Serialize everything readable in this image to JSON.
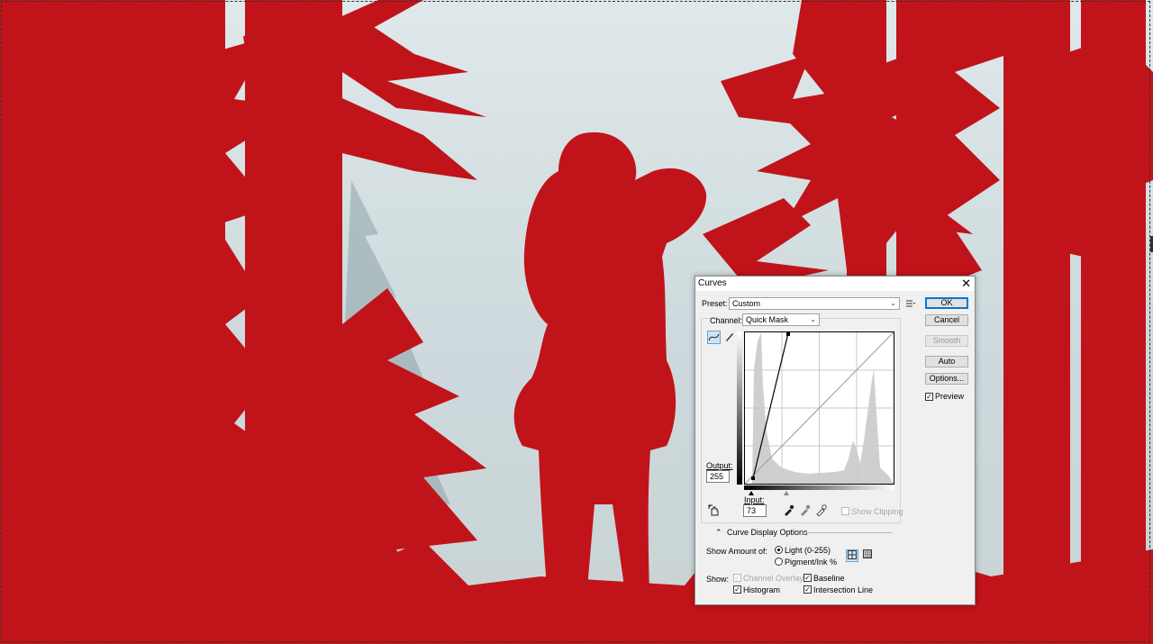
{
  "dialog": {
    "title": "Curves",
    "close_glyph": "✕",
    "preset_label": "Preset:",
    "preset_value": "Custom",
    "preset_options_icon": "preset-menu-icon",
    "channel_label": "Channel:",
    "channel_value": "Quick Mask",
    "buttons": {
      "ok": "OK",
      "cancel": "Cancel",
      "smooth": "Smooth",
      "auto": "Auto",
      "options": "Options..."
    },
    "preview_label": "Preview",
    "preview_checked": true,
    "output_label": "Output:",
    "output_value": "255",
    "input_label": "Input:",
    "input_value": "73",
    "show_clipping_label": "Show Clipping",
    "curve_display_options_label": "Curve Display Options",
    "show_amount_label": "Show Amount of:",
    "light_label": "Light  (0-255)",
    "pigment_label": "Pigment/Ink %",
    "show_label": "Show:",
    "channel_overlays_label": "Channel Overlays",
    "baseline_label": "Baseline",
    "histogram_label": "Histogram",
    "intersection_line_label": "Intersection Line",
    "curve_points": [
      [
        0,
        0
      ],
      [
        73,
        255
      ]
    ]
  },
  "canvas": {
    "mask_color": "#c0141a",
    "background_color": "#d8e3e6"
  }
}
